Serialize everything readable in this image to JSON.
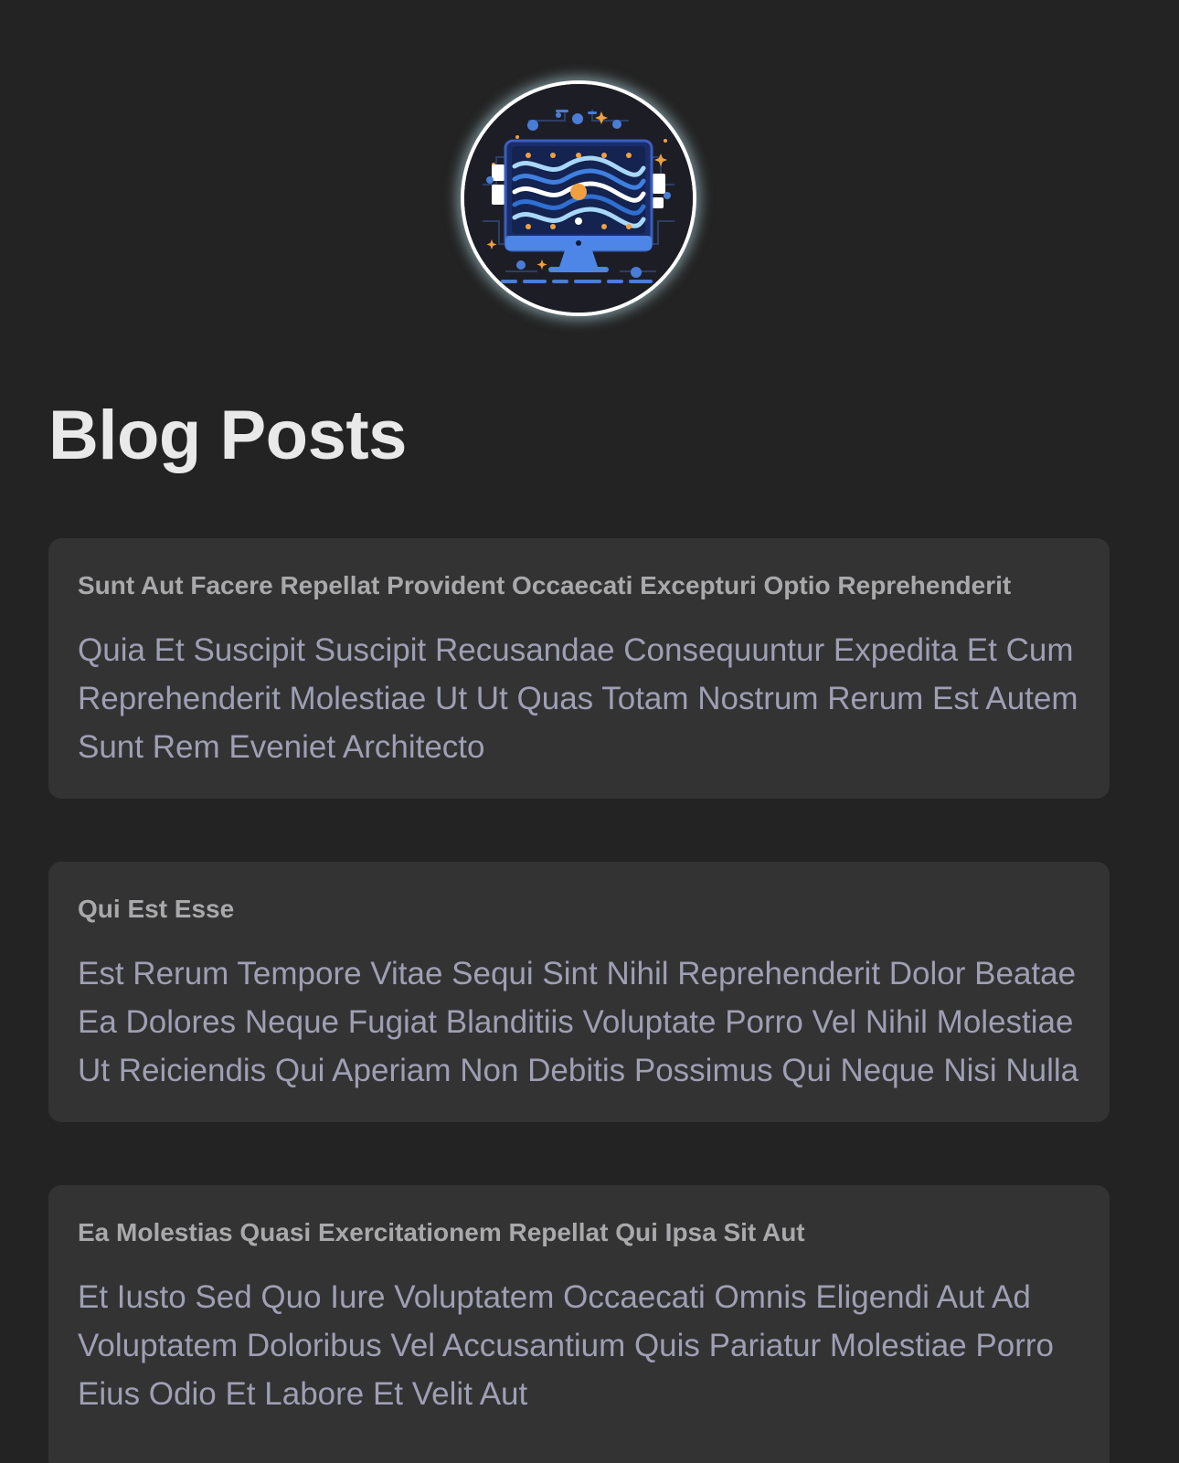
{
  "header": {
    "avatar_icon": "computer-waves-logo-icon",
    "title": "Blog Posts"
  },
  "colors": {
    "background": "#232323",
    "card": "#333334",
    "title_text": "#e9e9e9",
    "post_title_text": "#a9a9ab",
    "post_body_text": "#9f9fb4"
  },
  "posts": [
    {
      "title": "Sunt Aut Facere Repellat Provident Occaecati Excepturi Optio Reprehenderit",
      "body": "Quia Et Suscipit Suscipit Recusandae Consequuntur Expedita Et Cum Reprehenderit Molestiae Ut Ut Quas Totam Nostrum Rerum Est Autem Sunt Rem Eveniet Architecto"
    },
    {
      "title": "Qui Est Esse",
      "body": "Est Rerum Tempore Vitae Sequi Sint Nihil Reprehenderit Dolor Beatae Ea Dolores Neque Fugiat Blanditiis Voluptate Porro Vel Nihil Molestiae Ut Reiciendis Qui Aperiam Non Debitis Possimus Qui Neque Nisi Nulla"
    },
    {
      "title": "Ea Molestias Quasi Exercitationem Repellat Qui Ipsa Sit Aut",
      "body": "Et Iusto Sed Quo Iure Voluptatem Occaecati Omnis Eligendi Aut Ad Voluptatem Doloribus Vel Accusantium Quis Pariatur Molestiae Porro Eius Odio Et Labore Et Velit Aut"
    }
  ]
}
